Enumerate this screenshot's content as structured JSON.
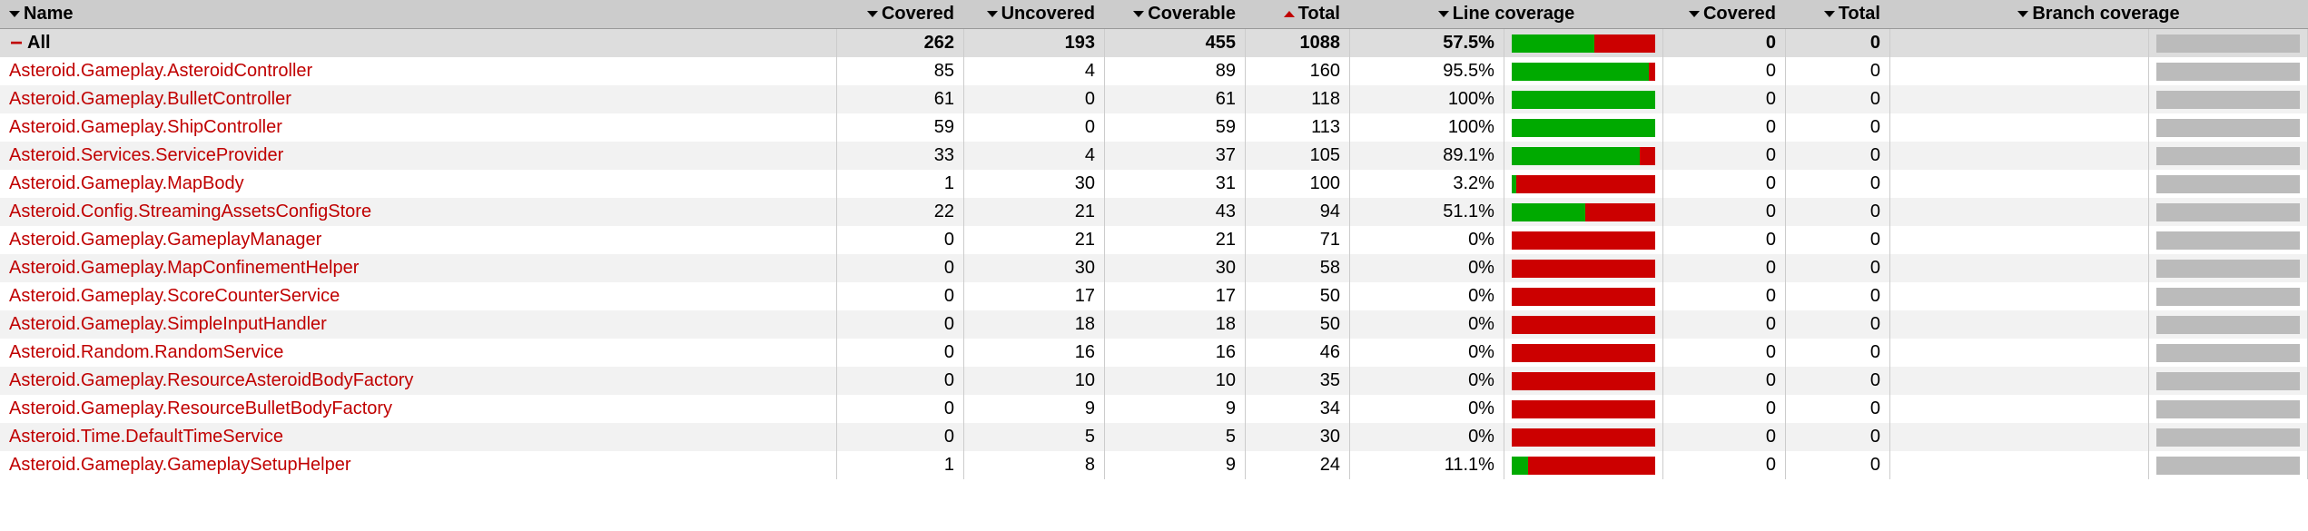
{
  "headers": {
    "name": "Name",
    "covered": "Covered",
    "uncovered": "Uncovered",
    "coverable": "Coverable",
    "total": "Total",
    "line_coverage": "Line coverage",
    "b_covered": "Covered",
    "b_total": "Total",
    "branch_coverage": "Branch coverage"
  },
  "summary": {
    "name": "All",
    "covered": 262,
    "uncovered": 193,
    "coverable": 455,
    "total": 1088,
    "line_pct": "57.5%",
    "green_pct": 57.5,
    "red_pct": 42.5,
    "b_covered": 0,
    "b_total": 0,
    "branch_pct": ""
  },
  "rows": [
    {
      "name": "Asteroid.Gameplay.AsteroidController",
      "covered": 85,
      "uncovered": 4,
      "coverable": 89,
      "total": 160,
      "line_pct": "95.5%",
      "green_pct": 95.5,
      "red_pct": 4.5,
      "b_covered": 0,
      "b_total": 0,
      "branch_pct": ""
    },
    {
      "name": "Asteroid.Gameplay.BulletController",
      "covered": 61,
      "uncovered": 0,
      "coverable": 61,
      "total": 118,
      "line_pct": "100%",
      "green_pct": 100,
      "red_pct": 0,
      "b_covered": 0,
      "b_total": 0,
      "branch_pct": ""
    },
    {
      "name": "Asteroid.Gameplay.ShipController",
      "covered": 59,
      "uncovered": 0,
      "coverable": 59,
      "total": 113,
      "line_pct": "100%",
      "green_pct": 100,
      "red_pct": 0,
      "b_covered": 0,
      "b_total": 0,
      "branch_pct": ""
    },
    {
      "name": "Asteroid.Services.ServiceProvider",
      "covered": 33,
      "uncovered": 4,
      "coverable": 37,
      "total": 105,
      "line_pct": "89.1%",
      "green_pct": 89.1,
      "red_pct": 10.9,
      "b_covered": 0,
      "b_total": 0,
      "branch_pct": ""
    },
    {
      "name": "Asteroid.Gameplay.MapBody",
      "covered": 1,
      "uncovered": 30,
      "coverable": 31,
      "total": 100,
      "line_pct": "3.2%",
      "green_pct": 3.2,
      "red_pct": 96.8,
      "b_covered": 0,
      "b_total": 0,
      "branch_pct": ""
    },
    {
      "name": "Asteroid.Config.StreamingAssetsConfigStore",
      "covered": 22,
      "uncovered": 21,
      "coverable": 43,
      "total": 94,
      "line_pct": "51.1%",
      "green_pct": 51.1,
      "red_pct": 48.9,
      "b_covered": 0,
      "b_total": 0,
      "branch_pct": ""
    },
    {
      "name": "Asteroid.Gameplay.GameplayManager",
      "covered": 0,
      "uncovered": 21,
      "coverable": 21,
      "total": 71,
      "line_pct": "0%",
      "green_pct": 0,
      "red_pct": 100,
      "b_covered": 0,
      "b_total": 0,
      "branch_pct": ""
    },
    {
      "name": "Asteroid.Gameplay.MapConfinementHelper",
      "covered": 0,
      "uncovered": 30,
      "coverable": 30,
      "total": 58,
      "line_pct": "0%",
      "green_pct": 0,
      "red_pct": 100,
      "b_covered": 0,
      "b_total": 0,
      "branch_pct": ""
    },
    {
      "name": "Asteroid.Gameplay.ScoreCounterService",
      "covered": 0,
      "uncovered": 17,
      "coverable": 17,
      "total": 50,
      "line_pct": "0%",
      "green_pct": 0,
      "red_pct": 100,
      "b_covered": 0,
      "b_total": 0,
      "branch_pct": ""
    },
    {
      "name": "Asteroid.Gameplay.SimpleInputHandler",
      "covered": 0,
      "uncovered": 18,
      "coverable": 18,
      "total": 50,
      "line_pct": "0%",
      "green_pct": 0,
      "red_pct": 100,
      "b_covered": 0,
      "b_total": 0,
      "branch_pct": ""
    },
    {
      "name": "Asteroid.Random.RandomService",
      "covered": 0,
      "uncovered": 16,
      "coverable": 16,
      "total": 46,
      "line_pct": "0%",
      "green_pct": 0,
      "red_pct": 100,
      "b_covered": 0,
      "b_total": 0,
      "branch_pct": ""
    },
    {
      "name": "Asteroid.Gameplay.ResourceAsteroidBodyFactory",
      "covered": 0,
      "uncovered": 10,
      "coverable": 10,
      "total": 35,
      "line_pct": "0%",
      "green_pct": 0,
      "red_pct": 100,
      "b_covered": 0,
      "b_total": 0,
      "branch_pct": ""
    },
    {
      "name": "Asteroid.Gameplay.ResourceBulletBodyFactory",
      "covered": 0,
      "uncovered": 9,
      "coverable": 9,
      "total": 34,
      "line_pct": "0%",
      "green_pct": 0,
      "red_pct": 100,
      "b_covered": 0,
      "b_total": 0,
      "branch_pct": ""
    },
    {
      "name": "Asteroid.Time.DefaultTimeService",
      "covered": 0,
      "uncovered": 5,
      "coverable": 5,
      "total": 30,
      "line_pct": "0%",
      "green_pct": 0,
      "red_pct": 100,
      "b_covered": 0,
      "b_total": 0,
      "branch_pct": ""
    },
    {
      "name": "Asteroid.Gameplay.GameplaySetupHelper",
      "covered": 1,
      "uncovered": 8,
      "coverable": 9,
      "total": 24,
      "line_pct": "11.1%",
      "green_pct": 11.1,
      "red_pct": 88.9,
      "b_covered": 0,
      "b_total": 0,
      "branch_pct": ""
    }
  ],
  "chart_data": {
    "type": "table",
    "title": "Code Coverage Report",
    "columns": [
      "Name",
      "Covered",
      "Uncovered",
      "Coverable",
      "Total",
      "Line coverage %",
      "Branch Covered",
      "Branch Total"
    ],
    "rows": [
      [
        "All",
        262,
        193,
        455,
        1088,
        57.5,
        0,
        0
      ],
      [
        "Asteroid.Gameplay.AsteroidController",
        85,
        4,
        89,
        160,
        95.5,
        0,
        0
      ],
      [
        "Asteroid.Gameplay.BulletController",
        61,
        0,
        61,
        118,
        100,
        0,
        0
      ],
      [
        "Asteroid.Gameplay.ShipController",
        59,
        0,
        59,
        113,
        100,
        0,
        0
      ],
      [
        "Asteroid.Services.ServiceProvider",
        33,
        4,
        37,
        105,
        89.1,
        0,
        0
      ],
      [
        "Asteroid.Gameplay.MapBody",
        1,
        30,
        31,
        100,
        3.2,
        0,
        0
      ],
      [
        "Asteroid.Config.StreamingAssetsConfigStore",
        22,
        21,
        43,
        94,
        51.1,
        0,
        0
      ],
      [
        "Asteroid.Gameplay.GameplayManager",
        0,
        21,
        21,
        71,
        0,
        0,
        0
      ],
      [
        "Asteroid.Gameplay.MapConfinementHelper",
        0,
        30,
        30,
        58,
        0,
        0,
        0
      ],
      [
        "Asteroid.Gameplay.ScoreCounterService",
        0,
        17,
        17,
        50,
        0,
        0,
        0
      ],
      [
        "Asteroid.Gameplay.SimpleInputHandler",
        0,
        18,
        18,
        50,
        0,
        0,
        0
      ],
      [
        "Asteroid.Random.RandomService",
        0,
        16,
        16,
        46,
        0,
        0,
        0
      ],
      [
        "Asteroid.Gameplay.ResourceAsteroidBodyFactory",
        0,
        10,
        10,
        35,
        0,
        0,
        0
      ],
      [
        "Asteroid.Gameplay.ResourceBulletBodyFactory",
        0,
        9,
        9,
        34,
        0,
        0,
        0
      ],
      [
        "Asteroid.Time.DefaultTimeService",
        0,
        5,
        5,
        30,
        0,
        0,
        0
      ],
      [
        "Asteroid.Gameplay.GameplaySetupHelper",
        1,
        8,
        9,
        24,
        11.1,
        0,
        0
      ]
    ]
  }
}
